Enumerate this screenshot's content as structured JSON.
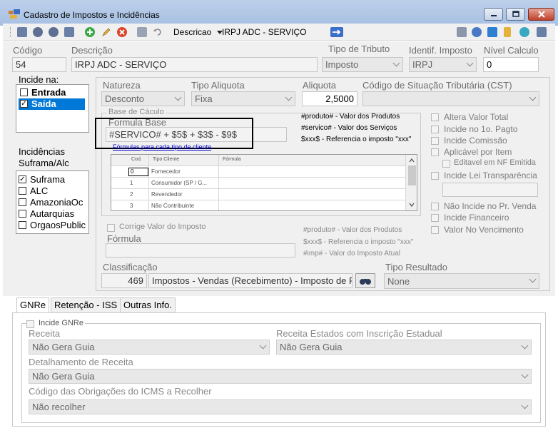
{
  "window": {
    "title": "Cadastro de Impostos e Incidências",
    "controls": [
      "minimize",
      "maximize",
      "close"
    ]
  },
  "toolbar": {
    "search_label": "Descricao",
    "search_value": "IRPJ ADC - SERVIÇO",
    "left_icons": [
      "first-icon",
      "prev-icon",
      "next-icon",
      "last-icon",
      "add-icon",
      "edit-icon",
      "delete-icon",
      "save-icon",
      "undo-icon"
    ],
    "right_icons": [
      "export-icon",
      "report-icon",
      "grid-icon",
      "help-icon",
      "user-icon",
      "exit-icon"
    ]
  },
  "header": {
    "codigo_label": "Código",
    "codigo_value": "54",
    "descricao_label": "Descrição",
    "descricao_value": "IRPJ ADC - SERVIÇO",
    "tipo_tributo_label": "Tipo de Tributo",
    "tipo_tributo_value": "Imposto",
    "identif_label": "Identif. Imposto",
    "identif_value": "IRPJ",
    "nivel_label": "Nível Calculo",
    "nivel_value": "0"
  },
  "incide_na": {
    "label": "Incide na:",
    "items": [
      {
        "label": "Entrada",
        "checked": false
      },
      {
        "label": "Saída",
        "checked": true
      }
    ]
  },
  "incidencias": {
    "label": "Incidências Suframa/Alc",
    "label_line1": "Incidências",
    "label_line2": "Suframa/Alc",
    "items": [
      {
        "label": "Suframa",
        "checked": true
      },
      {
        "label": "ALC",
        "checked": false
      },
      {
        "label": "AmazoniaOc",
        "checked": false
      },
      {
        "label": "Autarquias",
        "checked": false
      },
      {
        "label": "OrgaosPublic",
        "checked": false
      }
    ]
  },
  "calc": {
    "natureza_label": "Natureza",
    "natureza_value": "Desconto",
    "tipo_aliquota_label": "Tipo Aliquota",
    "tipo_aliquota_value": "Fixa",
    "aliquota_label": "Aliquota",
    "aliquota_value": "2,5000",
    "cst_label": "Código de Situação Tributária (CST)",
    "cst_value": ""
  },
  "base_calculo": {
    "group_label": "Base de Cáculo",
    "formula_label": "Formula Base",
    "formula_value": "#SERVICO# + $5$ + $3$ - $9$",
    "link": "Fórmulas para cada tipo de cliente",
    "hint1": "#produto# - Valor dos Produtos",
    "hint2": "#servico# - Valor dos Serviços",
    "hint3": "$xxx$ - Referencia o imposto \"xxx\""
  },
  "grid": {
    "headers": [
      "Cod.",
      "Tipo Cliente",
      "Fórmula"
    ],
    "rows": [
      {
        "cod": "0",
        "tipo": "Fornecedor",
        "formula": ""
      },
      {
        "cod": "1",
        "tipo": "Consumidor (SP / G...",
        "formula": ""
      },
      {
        "cod": "2",
        "tipo": "Revendedor",
        "formula": ""
      },
      {
        "cod": "3",
        "tipo": "Não Contribuinte",
        "formula": ""
      }
    ]
  },
  "flags": {
    "items": [
      {
        "label": "Altera Valor Total",
        "checked": false
      },
      {
        "label": "Incide no 1o. Pagto",
        "checked": false
      },
      {
        "label": "Incide Comissão",
        "checked": false
      },
      {
        "label": "Aplicável por Item",
        "checked": false
      },
      {
        "label": "Editavel em NF Emitida",
        "checked": false
      },
      {
        "label": "Incide Lei Transparência",
        "checked": false
      }
    ],
    "items_bottom": [
      {
        "label": "Não Incide no Pr. Venda",
        "checked": false
      },
      {
        "label": "Incide Financeiro",
        "checked": false
      },
      {
        "label": "Valor No Vencimento",
        "checked": false
      }
    ]
  },
  "corrige": {
    "label": "Corrige Valor do Imposto",
    "formula_label": "Fórmula",
    "hint1": "#produto# - Valor dos Produtos",
    "hint2": "$xxx$ - Referencia o imposto \"xxx\"",
    "hint3": "#imp# - Valor do Imposto Atual"
  },
  "classificacao": {
    "label": "Classificação",
    "code": "469",
    "text": "Impostos - Vendas (Recebimento) - Imposto de F",
    "tipo_resultado_label": "Tipo Resultado",
    "tipo_resultado_value": "None"
  },
  "tabs": [
    "GNRe",
    "Retenção - ISS",
    "Outras Info."
  ],
  "gnre": {
    "incide_label": "Incide GNRe",
    "receita_label": "Receita",
    "receita_value": "Não Gera Guia",
    "receita_estados_label": "Receita Estados com Inscrição Estadual",
    "receita_estados_value": "Não Gera Guia",
    "detalhamento_label": "Detalhamento de Receita",
    "detalhamento_value": "Não Gera Guia",
    "codigo_obrig_label": "Código das Obrigações do ICMS a Recolher",
    "codigo_obrig_value": "Não recolher"
  },
  "colors": {
    "titlebar": "#b3c8e6",
    "highlight": "#0078d7",
    "link": "#0000cc",
    "annotation_box": "#000000"
  }
}
